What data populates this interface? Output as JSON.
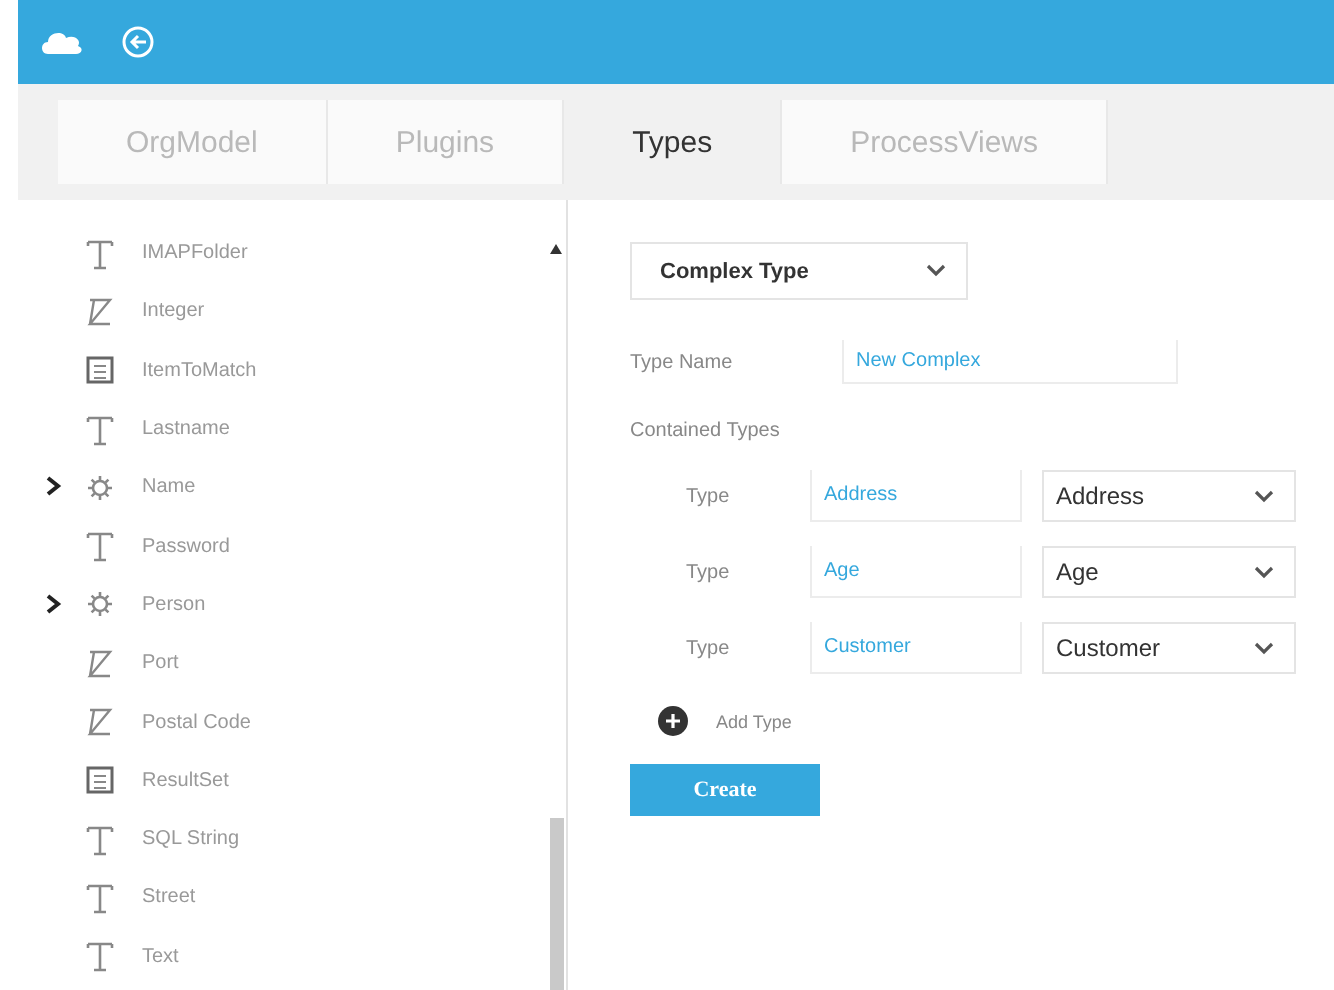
{
  "tabs": [
    {
      "label": "OrgModel",
      "selected": false
    },
    {
      "label": "Plugins",
      "selected": false
    },
    {
      "label": "Types",
      "selected": true
    },
    {
      "label": "ProcessViews",
      "selected": false
    }
  ],
  "type_list": [
    {
      "kind": "text",
      "label": "IMAPFolder",
      "expandable": false
    },
    {
      "kind": "integer",
      "label": "Integer",
      "expandable": false
    },
    {
      "kind": "record",
      "label": "ItemToMatch",
      "expandable": false
    },
    {
      "kind": "text",
      "label": "Lastname",
      "expandable": false
    },
    {
      "kind": "complex",
      "label": "Name",
      "expandable": true
    },
    {
      "kind": "text",
      "label": "Password",
      "expandable": false
    },
    {
      "kind": "complex",
      "label": "Person",
      "expandable": true
    },
    {
      "kind": "integer",
      "label": "Port",
      "expandable": false
    },
    {
      "kind": "integer",
      "label": "Postal Code",
      "expandable": false
    },
    {
      "kind": "record",
      "label": "ResultSet",
      "expandable": false
    },
    {
      "kind": "text",
      "label": "SQL String",
      "expandable": false
    },
    {
      "kind": "text",
      "label": "Street",
      "expandable": false
    },
    {
      "kind": "text",
      "label": "Text",
      "expandable": false
    }
  ],
  "form": {
    "type_select": "Complex Type",
    "type_name_label": "Type Name",
    "type_name_value": "New Complex",
    "contained_label": "Contained Types",
    "contained": [
      {
        "label": "Type",
        "name": "Address",
        "type": "Address"
      },
      {
        "label": "Type",
        "name": "Age",
        "type": "Age"
      },
      {
        "label": "Type",
        "name": "Customer",
        "type": "Customer"
      }
    ],
    "add_label": "Add Type",
    "create_label": "Create"
  }
}
